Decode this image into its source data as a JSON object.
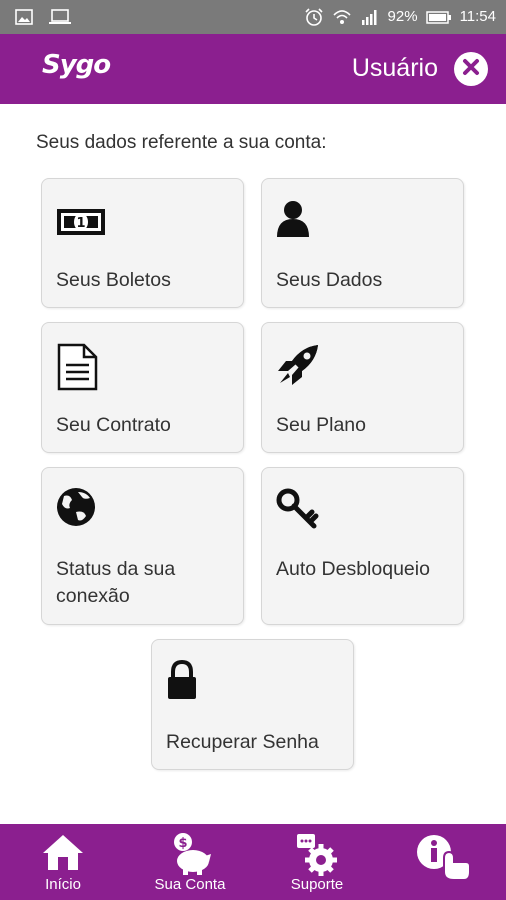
{
  "status_bar": {
    "battery": "92%",
    "time": "11:54",
    "icons": [
      "image-icon",
      "laptop-icon",
      "alarm-icon",
      "wifi-icon",
      "signal-icon",
      "battery-icon"
    ]
  },
  "header": {
    "logo": "Sygo",
    "title": "Usuário",
    "close_icon": "close-icon"
  },
  "intro": "Seus dados referente a sua conta:",
  "tiles": [
    {
      "label": "Seus Boletos",
      "icon": "banknote-icon"
    },
    {
      "label": "Seus Dados",
      "icon": "user-icon"
    },
    {
      "label": "Seu Contrato",
      "icon": "document-icon"
    },
    {
      "label": "Seu Plano",
      "icon": "rocket-icon"
    },
    {
      "label": "Status da sua conexão",
      "icon": "globe-icon"
    },
    {
      "label": "Auto Desbloqueio",
      "icon": "key-icon"
    },
    {
      "label": "Recuperar Senha",
      "icon": "lock-icon"
    }
  ],
  "bottom_nav": [
    {
      "label": "Início",
      "icon": "home-icon"
    },
    {
      "label": "Sua Conta",
      "icon": "piggy-bank-icon"
    },
    {
      "label": "Suporte",
      "icon": "support-gear-icon"
    },
    {
      "label": "",
      "icon": "info-tap-icon"
    }
  ],
  "colors": {
    "primary": "#8b1f8f",
    "status_bar": "#7a7a7a",
    "tile_bg": "#f4f4f4"
  }
}
